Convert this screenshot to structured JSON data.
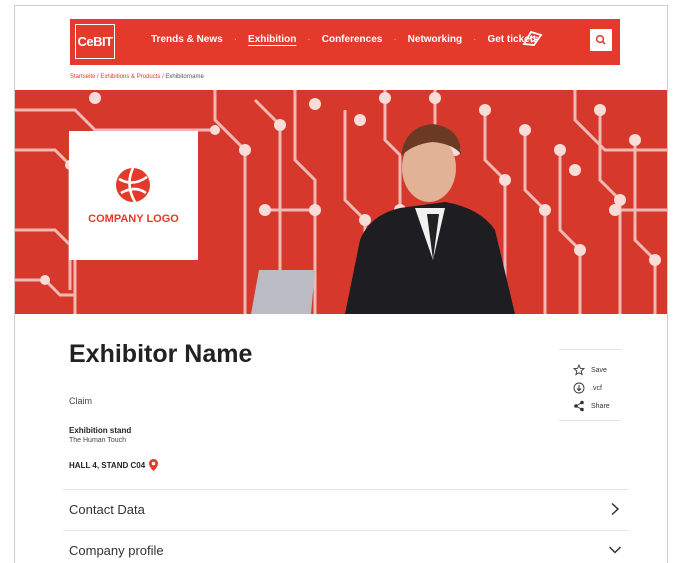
{
  "header": {
    "logo": "CeBIT",
    "nav": [
      "Trends & News",
      "Exhibition",
      "Conferences",
      "Networking",
      "Get tickets"
    ],
    "active_index": 1
  },
  "breadcrumb": {
    "items": [
      "Startseite",
      "Exhibitions & Products"
    ],
    "current": "Exhibitorname"
  },
  "hero": {
    "logo_text": "COMPANY LOGO"
  },
  "exhibitor": {
    "name": "Exhibitor Name",
    "claim": "Claim",
    "stand_heading": "Exhibition stand",
    "stand_subtitle": "The Human Touch",
    "hall": "HALL 4, STAND C04"
  },
  "actions": {
    "save": "Save",
    "vcf": ".vcf",
    "share": "Share"
  },
  "sections": {
    "contact": "Contact Data",
    "profile": "Company profile"
  },
  "colors": {
    "brand": "#e43a2b"
  }
}
